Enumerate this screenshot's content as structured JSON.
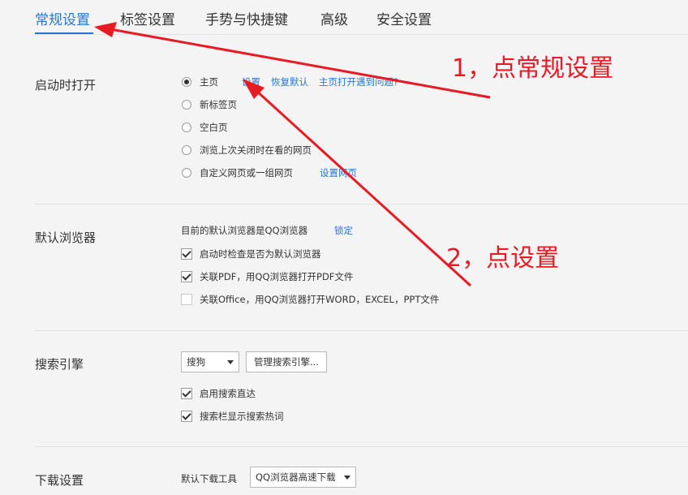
{
  "tabs": [
    {
      "label": "常规设置",
      "active": true
    },
    {
      "label": "标签设置"
    },
    {
      "label": "手势与快捷键"
    },
    {
      "label": "高级"
    },
    {
      "label": "安全设置"
    }
  ],
  "startup": {
    "title": "启动时打开",
    "options": [
      {
        "label": "主页",
        "selected": true
      },
      {
        "label": "新标签页"
      },
      {
        "label": "空白页"
      },
      {
        "label": "浏览上次关闭时在看的网页"
      },
      {
        "label": "自定义网页或一组网页"
      }
    ],
    "home_links": [
      "设置",
      "恢复默认",
      "主页打开遇到问题?"
    ],
    "custom_link": "设置网页"
  },
  "default_browser": {
    "title": "默认浏览器",
    "status": "目前的默认浏览器是QQ浏览器",
    "lock_link": "锁定",
    "checks": [
      {
        "label": "启动时检查是否为默认浏览器",
        "checked": true
      },
      {
        "label": "关联PDF，用QQ浏览器打开PDF文件",
        "checked": true
      },
      {
        "label": "关联Office，用QQ浏览器打开WORD，EXCEL，PPT文件",
        "checked": false
      }
    ]
  },
  "search": {
    "title": "搜索引擎",
    "engine": "搜狗",
    "manage_button": "管理搜索引擎...",
    "checks": [
      {
        "label": "启用搜索直达",
        "checked": true
      },
      {
        "label": "搜索栏显示搜索热词",
        "checked": true
      }
    ]
  },
  "download": {
    "title": "下载设置",
    "tool_label": "默认下载工具",
    "tool_value": "QQ浏览器高速下载"
  },
  "annotations": {
    "step1": "1，点常规设置",
    "step2": "2，点设置",
    "color": "#e81b24"
  },
  "colors": {
    "accent": "#2a76d4",
    "background": "#f4f4f5"
  }
}
